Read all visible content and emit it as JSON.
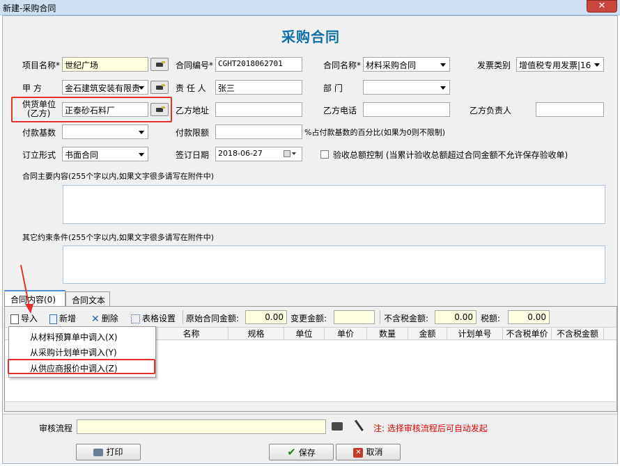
{
  "window": {
    "title": "新建-采购合同",
    "close_symbol": "✕"
  },
  "form": {
    "title": "采购合同",
    "project_label": "项目名称*",
    "project_value": "世纪广场",
    "contract_no_label": "合同编号*",
    "contract_no_value": "CGHT2018062701",
    "contract_name_label": "合同名称*",
    "contract_name_value": "材料采购合同",
    "invoice_type_label": "发票类别",
    "invoice_type_value": "增值税专用发票|16",
    "party_a_label": "甲    方",
    "party_a_value": "金石建筑安装有限责",
    "responsible_label": "责 任 人",
    "responsible_value": "张三",
    "dept_label": "部    门",
    "dept_value": "",
    "supplier_label_1": "供货单位",
    "supplier_label_2": "(乙方)",
    "supplier_value": "正泰砂石料厂",
    "party_b_address_label": "乙方地址",
    "party_b_phone_label": "乙方电话",
    "party_b_manager_label": "乙方负责人",
    "pay_base_label": "付款基数",
    "pay_limit_label": "付款限额",
    "pay_limit_hint": "%占付款基数的百分比(如果为0则不限制)",
    "form_type_label": "订立形式",
    "form_type_value": "书面合同",
    "sign_date_label": "签订日期",
    "sign_date_value": "2018-06-27",
    "acceptance_label": "验收总额控制 (当累计验收总额超过合同金额不允许保存验收单)",
    "main_content_label": "合同主要内容(255个字以内,如果文字很多请写在附件中)",
    "other_terms_label": "其它约束条件(255个字以内,如果文字很多请写在附件中)"
  },
  "tabs": [
    {
      "label": "合同内容(0)"
    },
    {
      "label": "合同文本"
    }
  ],
  "toolbar": {
    "import": "导入",
    "add": "新增",
    "delete": "删除",
    "table_settings": "表格设置",
    "orig_amount_label": "原始合同金额:",
    "orig_amount_value": "0.00",
    "change_amount_label": "变更金额:",
    "change_amount_value": "",
    "notax_amount_label": "不含税金额:",
    "notax_amount_value": "0.00",
    "tax_label": "税额:",
    "tax_value": "0.00"
  },
  "table": {
    "columns": [
      "名称",
      "规格",
      "单位",
      "单价",
      "数量",
      "金额",
      "计划单号",
      "不含税单价",
      "不含税金额"
    ]
  },
  "import_menu": {
    "items": [
      "从材料预算单中调入(X)",
      "从采购计划单中调入(Y)",
      "从供应商报价中调入(Z)"
    ]
  },
  "footer": {
    "audit_label": "审核流程",
    "audit_note": "注: 选择审核流程后可自动发起",
    "print": "打印",
    "save": "保存",
    "cancel": "取消"
  },
  "colors": {
    "accent": "#0e6ea8",
    "highlight": "#e5302b",
    "note": "#e00000"
  }
}
